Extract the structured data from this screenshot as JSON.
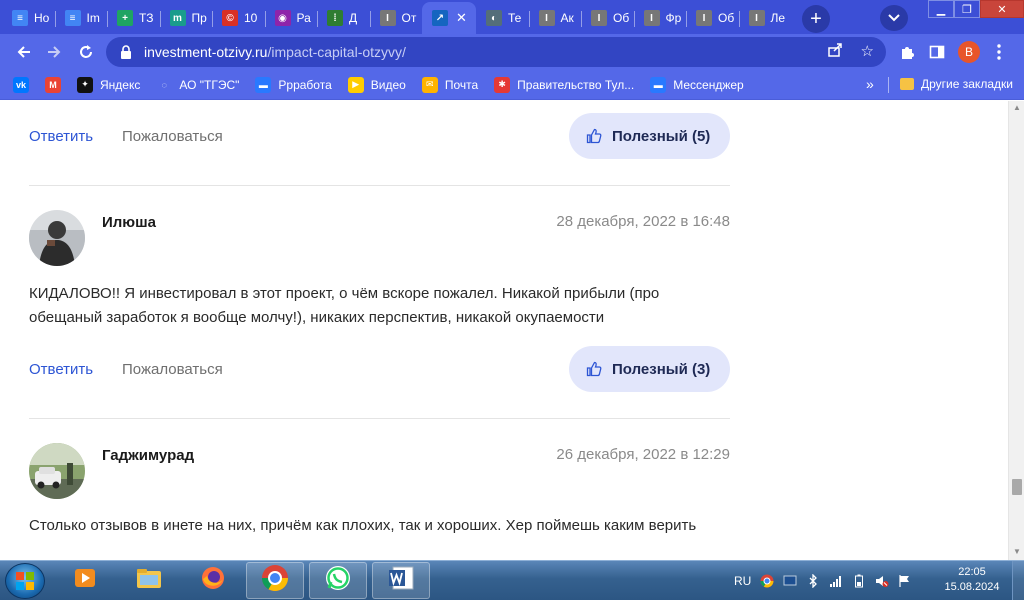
{
  "browser": {
    "tabs": [
      {
        "label": "Но",
        "icon": "docs-icon",
        "color": "#4285f4"
      },
      {
        "label": "Im",
        "icon": "docs-icon",
        "color": "#4285f4"
      },
      {
        "label": "ТЗ",
        "icon": "sheets-plus-icon",
        "color": "#1fa463"
      },
      {
        "label": "Пр",
        "icon": "m-icon",
        "color": "#1a9c8c"
      },
      {
        "label": "10",
        "icon": "copyright-icon",
        "color": "#d93025"
      },
      {
        "label": "Ра",
        "icon": "circle-p-icon",
        "color": "#8e24aa"
      },
      {
        "label": "Д",
        "icon": "dots-grid-icon",
        "color": "#2e7d32"
      },
      {
        "label": "От",
        "icon": "bar-icon",
        "color": "#777777"
      },
      {
        "label": "",
        "icon": "chart-up-icon",
        "color": "#1565c0",
        "active": true
      },
      {
        "label": "Те",
        "icon": "globe-icon",
        "color": "#546e7a"
      },
      {
        "label": "Ак",
        "icon": "bar-icon",
        "color": "#777777"
      },
      {
        "label": "Об",
        "icon": "bar-icon",
        "color": "#777777"
      },
      {
        "label": "Фр",
        "icon": "bar-icon",
        "color": "#777777"
      },
      {
        "label": "Об",
        "icon": "bar-icon",
        "color": "#777777"
      },
      {
        "label": "Ле",
        "icon": "bar-icon",
        "color": "#777777"
      }
    ],
    "tab_close": "✕",
    "url_host": "investment-otzivy.ru",
    "url_path": "/impact-capital-otzyvy/",
    "profile_initial": "B",
    "bookmarks": [
      {
        "label": "",
        "icon": "vk-icon",
        "color": "#0077ff"
      },
      {
        "label": "",
        "icon": "gmail-icon",
        "color": "#ea4335"
      },
      {
        "label": "Яндекс",
        "icon": "yandex-icon",
        "color": "#111111"
      },
      {
        "label": "АО \"ТГЭС\"",
        "icon": "loading-icon",
        "color": "#5468e8"
      },
      {
        "label": "Ррработа",
        "icon": "chat-icon",
        "color": "#2979ff"
      },
      {
        "label": "Видео",
        "icon": "play-icon",
        "color": "#ffcc00"
      },
      {
        "label": "Почта",
        "icon": "mail-icon",
        "color": "#ffb300"
      },
      {
        "label": "Правительство Тул...",
        "icon": "emblem-icon",
        "color": "#e53935"
      },
      {
        "label": "Мессенджер",
        "icon": "chat-icon",
        "color": "#2979ff"
      }
    ],
    "bookmarks_more": "»",
    "other_bookmarks": "Другие закладки"
  },
  "page": {
    "reply_label": "Ответить",
    "complain_label": "Пожаловаться",
    "comments": [
      {
        "useful": "Полезный (5)"
      },
      {
        "author": "Илюша",
        "date": "28 декабря, 2022 в 16:48",
        "text": "КИДАЛОВО!! Я инвестировал в этот проект, о чём вскоре пожалел. Никакой прибыли (про обещаный заработок я вообще молчу!), никаких перспектив, никакой окупаемости",
        "useful": "Полезный (3)"
      },
      {
        "author": "Гаджимурад",
        "date": "26 декабря, 2022 в 12:29",
        "text": "Столько отзывов в инете на них, причём как плохих, так и хороших. Хер поймешь каким верить"
      }
    ]
  },
  "taskbar": {
    "apps": [
      {
        "icon": "media-player-icon"
      },
      {
        "icon": "explorer-icon"
      },
      {
        "icon": "firefox-icon"
      },
      {
        "icon": "chrome-icon",
        "open": true
      },
      {
        "icon": "whatsapp-icon",
        "open": true
      },
      {
        "icon": "word-icon",
        "open": true
      }
    ],
    "lang": "RU",
    "time": "22:05",
    "date": "15.08.2024"
  }
}
